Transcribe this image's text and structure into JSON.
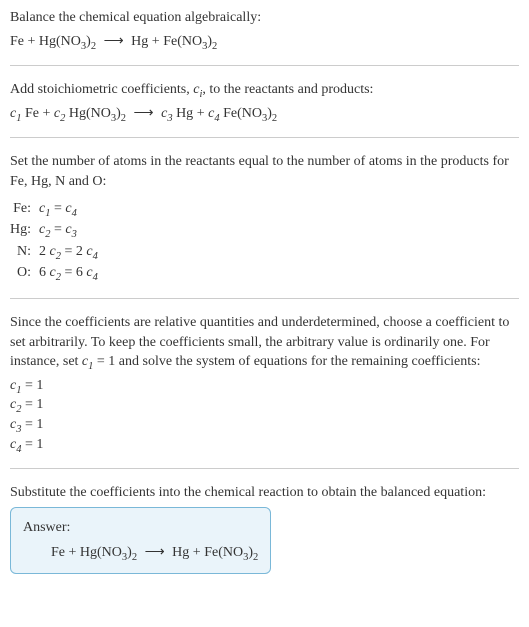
{
  "intro": {
    "line1": "Balance the chemical equation algebraically:"
  },
  "step1": {
    "text": "Add stoichiometric coefficients, ",
    "text2": ", to the reactants and products:"
  },
  "step2": {
    "text": "Set the number of atoms in the reactants equal to the number of atoms in the products for Fe, Hg, N and O:",
    "rows": [
      {
        "el": "Fe:"
      },
      {
        "el": "Hg:"
      },
      {
        "el": "N:"
      },
      {
        "el": "O:"
      }
    ]
  },
  "step3": {
    "text": "Since the coefficients are relative quantities and underdetermined, choose a coefficient to set arbitrarily. To keep the coefficients small, the arbitrary value is ordinarily one. For instance, set ",
    "text2": " = 1 and solve the system of equations for the remaining coefficients:",
    "coefs_vals": [
      "1",
      "1",
      "1",
      "1"
    ]
  },
  "step4": {
    "text": "Substitute the coefficients into the chemical reaction to obtain the balanced equation:"
  },
  "answer": {
    "label": "Answer:"
  },
  "chem": {
    "Fe": "Fe",
    "Hg": "Hg",
    "HgNO32_a": "Hg(NO",
    "HgNO32_b": ")",
    "FeNO32_a": "Fe(NO",
    "FeNO32_b": ")",
    "three": "3",
    "two": "2",
    "plus": " + ",
    "arrow": "⟶",
    "c": "c",
    "one": "1",
    "four": "4",
    "eq": " = ",
    "twotimes": "2 ",
    "sixtimes": "6 "
  },
  "chart_data": {
    "type": "table",
    "title": "Atom balance equations",
    "elements": [
      "Fe",
      "Hg",
      "N",
      "O"
    ],
    "equations": [
      "c1 = c4",
      "c2 = c3",
      "2 c2 = 2 c4",
      "6 c2 = 6 c4"
    ],
    "solved_coefficients": {
      "c1": 1,
      "c2": 1,
      "c3": 1,
      "c4": 1
    },
    "unbalanced": "Fe + Hg(NO3)2 -> Hg + Fe(NO3)2",
    "balanced": "Fe + Hg(NO3)2 -> Hg + Fe(NO3)2"
  }
}
